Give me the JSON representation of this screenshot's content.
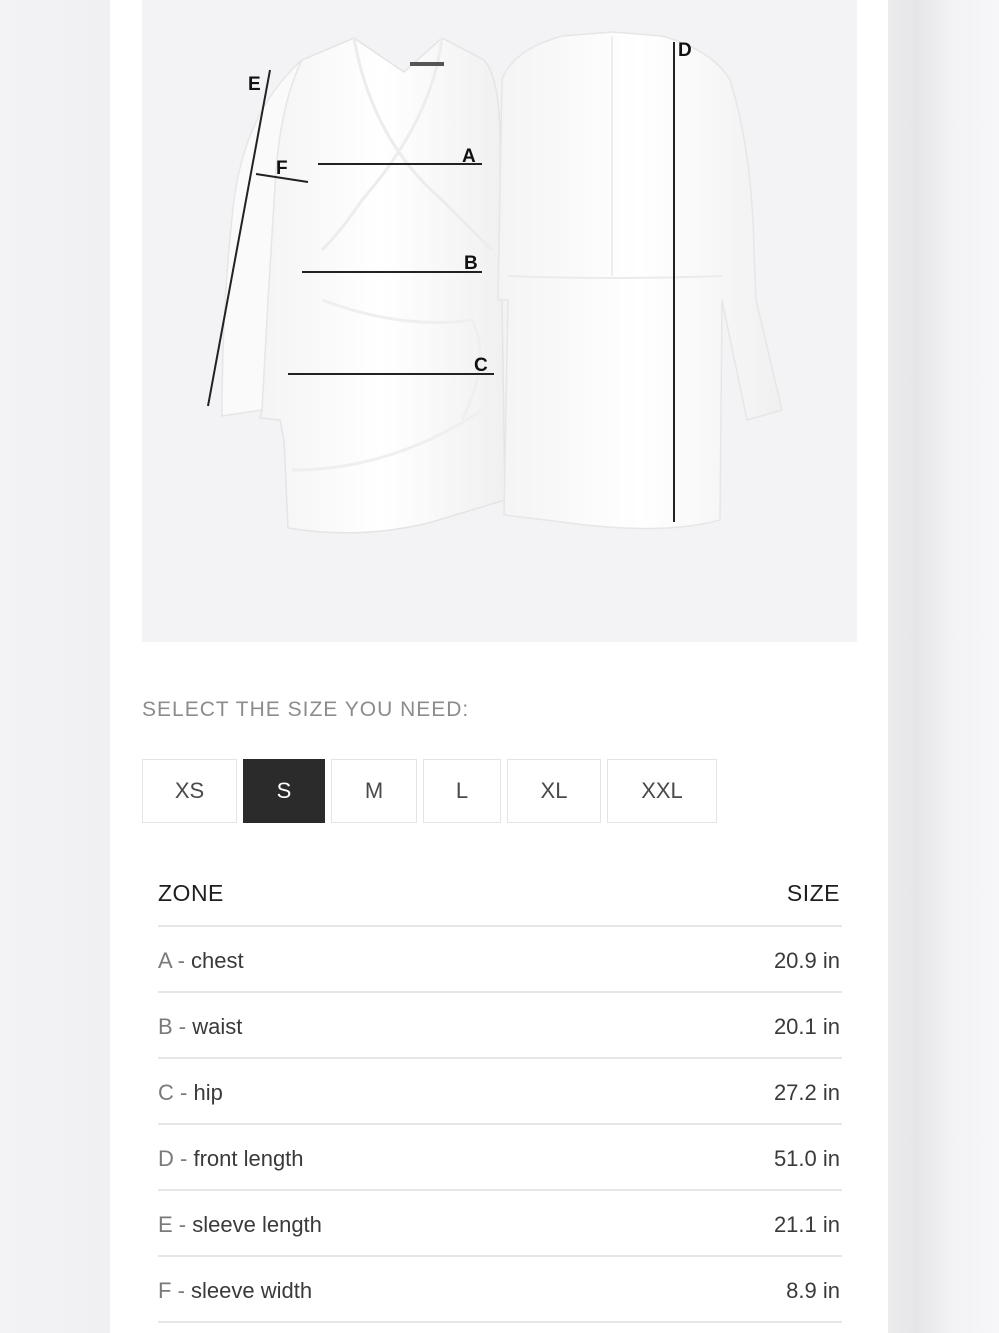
{
  "diagram": {
    "labels": [
      "A",
      "B",
      "C",
      "D",
      "E",
      "F"
    ]
  },
  "size_selector": {
    "heading": "SELECT THE SIZE YOU NEED:",
    "options": [
      "XS",
      "S",
      "M",
      "L",
      "XL",
      "XXL"
    ],
    "selected": "S"
  },
  "size_table": {
    "header_zone": "ZONE",
    "header_size": "SIZE",
    "rows": [
      {
        "letter": "A",
        "sep": " - ",
        "zone": "chest",
        "value": "20.9 in"
      },
      {
        "letter": "B",
        "sep": " - ",
        "zone": "waist",
        "value": "20.1 in"
      },
      {
        "letter": "C",
        "sep": " - ",
        "zone": "hip",
        "value": "27.2 in"
      },
      {
        "letter": "D",
        "sep": " - ",
        "zone": "front length",
        "value": "51.0 in"
      },
      {
        "letter": "E",
        "sep": " - ",
        "zone": "sleeve length",
        "value": "21.1 in"
      },
      {
        "letter": "F",
        "sep": " - ",
        "zone": "sleeve width",
        "value": "8.9 in"
      }
    ]
  },
  "colors": {
    "selected_bg": "#2b2b2b",
    "page_bg": "#f1f1f3",
    "image_bg": "#f3f3f5"
  }
}
